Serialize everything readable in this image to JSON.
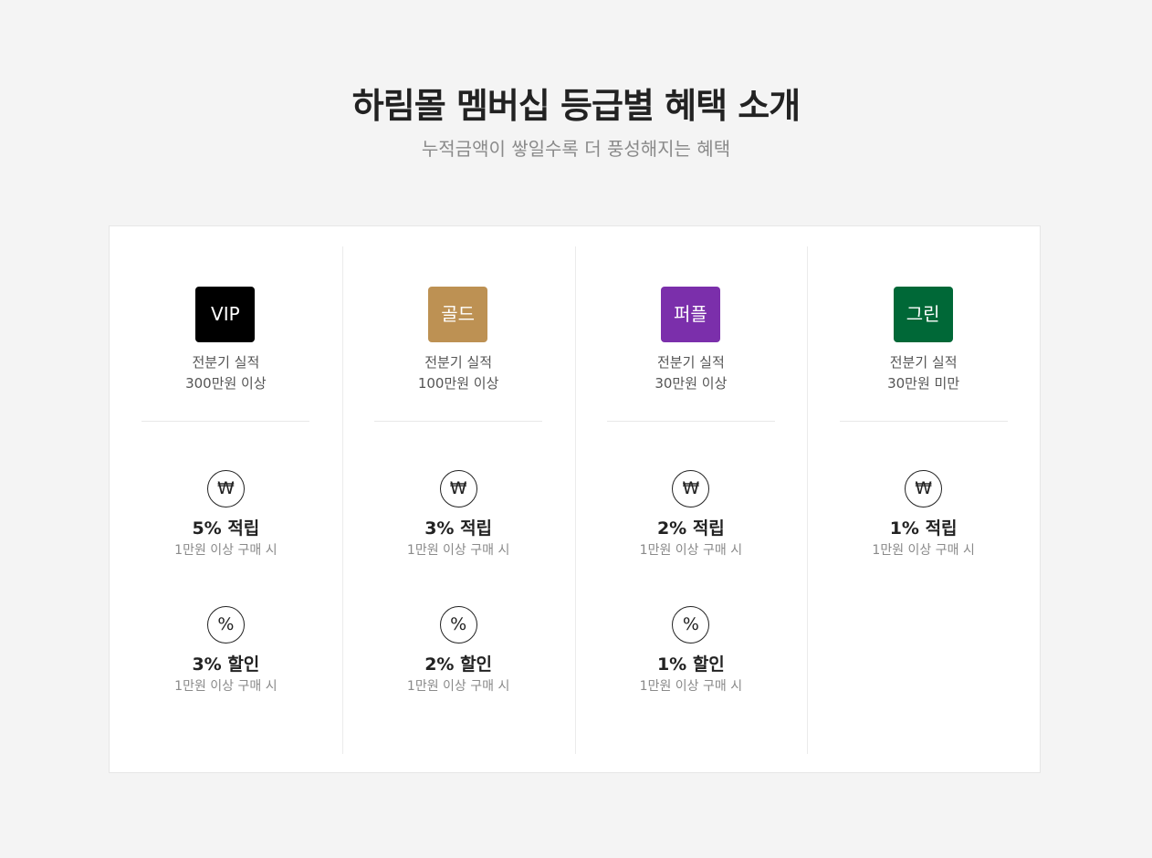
{
  "header": {
    "title": "하림몰 멤버십 등급별 혜택 소개",
    "subtitle": "누적금액이 쌓일수록 더 풍성해지는 혜택"
  },
  "tiers": [
    {
      "badge": "VIP",
      "color": "#000000",
      "condition_line1": "전분기 실적",
      "condition_line2": "300만원 이상",
      "benefits": [
        {
          "icon": "won-icon",
          "symbol": "₩",
          "title": "5% 적립",
          "note": "1만원 이상 구매 시"
        },
        {
          "icon": "percent-icon",
          "symbol": "%",
          "title": "3% 할인",
          "note": "1만원 이상 구매 시"
        }
      ]
    },
    {
      "badge": "골드",
      "color": "#bd9153",
      "condition_line1": "전분기 실적",
      "condition_line2": "100만원 이상",
      "benefits": [
        {
          "icon": "won-icon",
          "symbol": "₩",
          "title": "3% 적립",
          "note": "1만원 이상 구매 시"
        },
        {
          "icon": "percent-icon",
          "symbol": "%",
          "title": "2% 할인",
          "note": "1만원 이상 구매 시"
        }
      ]
    },
    {
      "badge": "퍼플",
      "color": "#7b2fab",
      "condition_line1": "전분기 실적",
      "condition_line2": "30만원 이상",
      "benefits": [
        {
          "icon": "won-icon",
          "symbol": "₩",
          "title": "2% 적립",
          "note": "1만원 이상 구매 시"
        },
        {
          "icon": "percent-icon",
          "symbol": "%",
          "title": "1% 할인",
          "note": "1만원 이상 구매 시"
        }
      ]
    },
    {
      "badge": "그린",
      "color": "#006837",
      "condition_line1": "전분기 실적",
      "condition_line2": "30만원 미만",
      "benefits": [
        {
          "icon": "won-icon",
          "symbol": "₩",
          "title": "1% 적립",
          "note": "1만원 이상 구매 시"
        }
      ]
    }
  ]
}
